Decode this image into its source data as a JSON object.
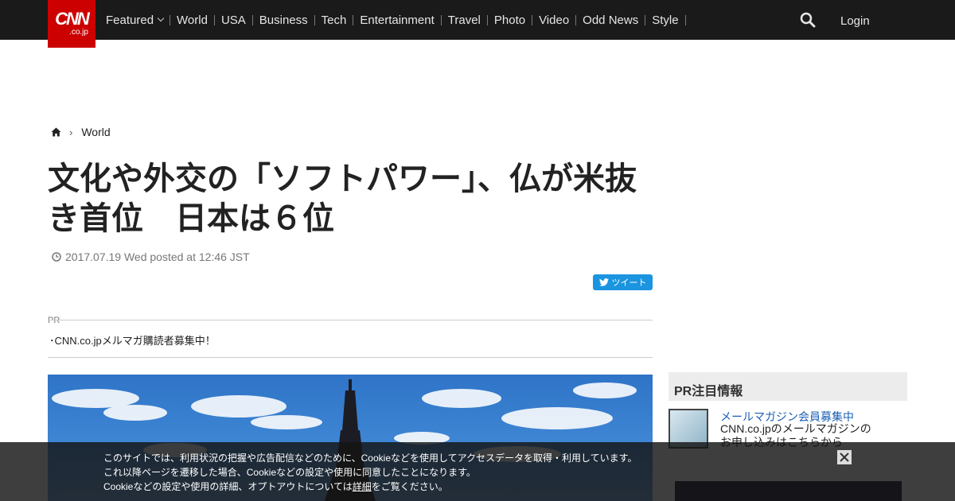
{
  "header": {
    "logo_text": "CNN",
    "logo_sub": ".co.jp",
    "nav": [
      "Featured",
      "World",
      "USA",
      "Business",
      "Tech",
      "Entertainment",
      "Travel",
      "Photo",
      "Video",
      "Odd News",
      "Style"
    ],
    "login": "Login",
    "search_icon": "search-icon"
  },
  "breadcrumb": {
    "home_icon": "home-icon",
    "section": "World"
  },
  "article": {
    "title": "文化や外交の「ソフトパワー」、仏が米抜き首位　日本は６位",
    "date": "2017.07.19 Wed posted at 12:46 JST",
    "tweet_label": "ツイート"
  },
  "pr": {
    "label": "PR",
    "link": "･CNN.co.jpメルマガ購読者募集中！"
  },
  "sidebar": {
    "pr_heading": "PR注目情報",
    "mag_title": "メールマガジン会員募集中",
    "mag_desc": "CNN.co.jpのメールマガジンのお申し込みはこちらから"
  },
  "cookie": {
    "line1": "このサイトでは、利用状況の把握や広告配信などのために、Cookieなどを使用してアクセスデータを取得・利用しています。",
    "line2": "これ以降ページを遷移した場合、Cookieなどの設定や使用に同意したことになります。",
    "line3_pre": "Cookieなどの設定や使用の詳細、オプトアウトについては",
    "line3_link": "詳細",
    "line3_post": "をご覧ください。"
  },
  "colors": {
    "brand": "#cc0000",
    "topbar": "#1a1a1a",
    "tweet": "#1b95e0"
  }
}
